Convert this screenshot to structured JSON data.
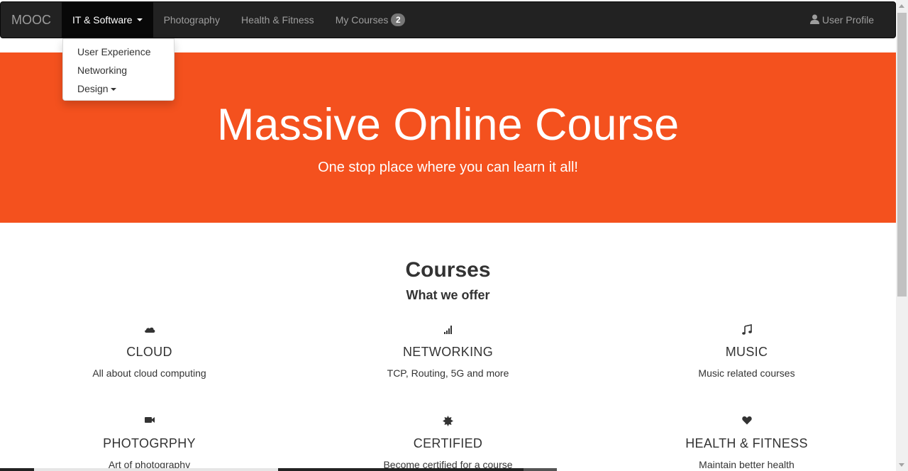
{
  "navbar": {
    "brand": "MOOC",
    "items": [
      {
        "label": "IT & Software",
        "active": true,
        "dropdown": true
      },
      {
        "label": "Photography"
      },
      {
        "label": "Health & Fitness"
      },
      {
        "label": "My Courses",
        "badge": "2"
      }
    ],
    "user_profile": "User Profile"
  },
  "dropdown": {
    "items": [
      "User Experience",
      "Networking",
      "Design"
    ]
  },
  "hero": {
    "title": "Massive Online Course",
    "subtitle": "One stop place where you can learn it all!",
    "background": "#f4511e"
  },
  "courses": {
    "title": "Courses",
    "subtitle": "What we offer",
    "items": [
      {
        "icon": "cloud-icon",
        "title": "CLOUD",
        "description": "All about cloud computing"
      },
      {
        "icon": "signal-icon",
        "title": "NETWORKING",
        "description": "TCP, Routing, 5G and more"
      },
      {
        "icon": "music-icon",
        "title": "MUSIC",
        "description": "Music related courses"
      },
      {
        "icon": "video-camera-icon",
        "title": "PHOTOGRPHY",
        "description": "Art of photography"
      },
      {
        "icon": "certificate-icon",
        "title": "CERTIFIED",
        "description": "Become certified for a course"
      },
      {
        "icon": "heart-icon",
        "title": "HEALTH & FITNESS",
        "description": "Maintain better health"
      }
    ]
  }
}
